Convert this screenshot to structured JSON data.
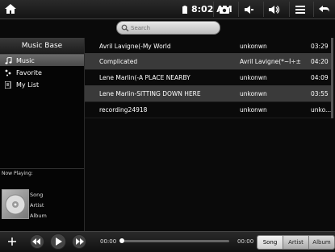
{
  "status_bar": {
    "time": "8:02 AM",
    "icons": [
      "home-icon",
      "camera-icon",
      "volume-down-icon",
      "volume-up-icon",
      "menu-icon",
      "back-icon"
    ]
  },
  "search": {
    "placeholder": "Search"
  },
  "sidebar": {
    "title": "Music Base",
    "items": [
      {
        "label": "Music",
        "icon": "music-note-icon",
        "active": true
      },
      {
        "label": "Favorite",
        "icon": "favorite-icon",
        "active": false
      },
      {
        "label": "My List",
        "icon": "playlist-icon",
        "active": false
      }
    ]
  },
  "now_playing": {
    "label": "Now Playing:",
    "song": "Song",
    "artist": "Artist",
    "album": "Album"
  },
  "songs": [
    {
      "title": "Avril Lavigne(-My World",
      "artist": "unkonwn",
      "duration": "03:29",
      "selected": false
    },
    {
      "title": "Complicated",
      "artist": "Avril Lavigne(*~Ì÷±¶Ú)",
      "duration": "04:20",
      "selected": true
    },
    {
      "title": "Lene Marlin(-A PLACE NEARBY",
      "artist": "unkonwn",
      "duration": "04:09",
      "selected": false
    },
    {
      "title": "Lene Marlin-SITTING DOWN HERE",
      "artist": "unkonwn",
      "duration": "03:55",
      "selected": true
    },
    {
      "title": "recording24918",
      "artist": "unkonwn",
      "duration": "unko...",
      "selected": false
    }
  ],
  "player": {
    "elapsed": "00:00",
    "total": "00:00",
    "progress": 0,
    "sort_tabs": [
      "Song",
      "Artist",
      "Album"
    ],
    "active_tab": "Song"
  }
}
